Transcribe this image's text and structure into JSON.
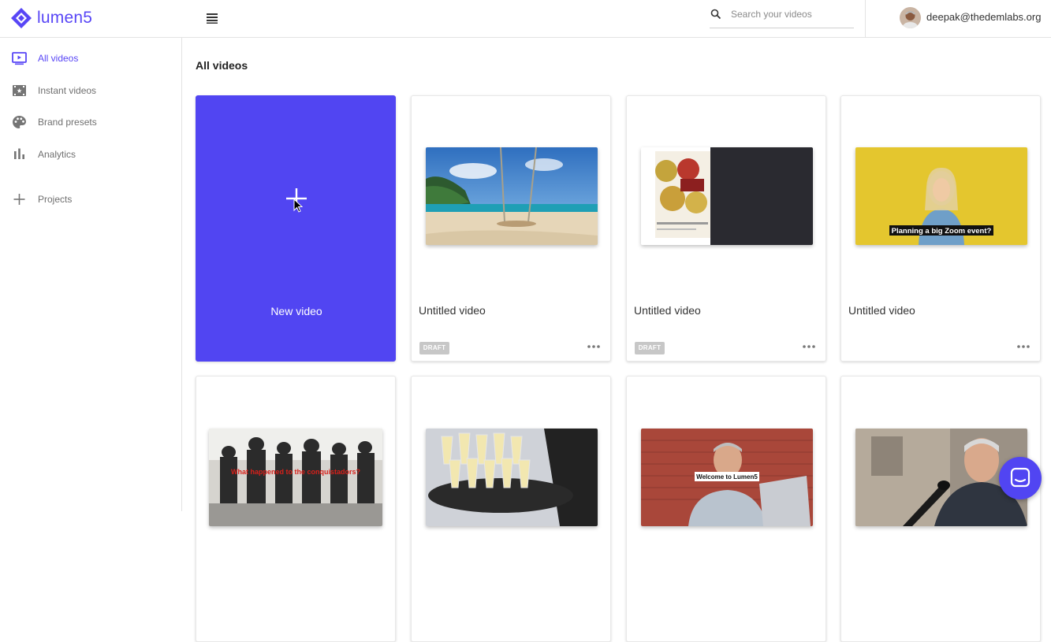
{
  "brand": {
    "name": "lumen5",
    "accent": "#5846f6",
    "primary_button": "#5145f2"
  },
  "header": {
    "search": {
      "placeholder": "Search your videos",
      "value": ""
    },
    "user": {
      "email": "deepak@thedemlabs.org"
    }
  },
  "sidebar": {
    "items": [
      {
        "label": "All videos",
        "icon": "play-screen-icon",
        "active": true
      },
      {
        "label": "Instant videos",
        "icon": "film-icon",
        "active": false
      },
      {
        "label": "Brand presets",
        "icon": "palette-icon",
        "active": false
      },
      {
        "label": "Analytics",
        "icon": "bar-chart-icon",
        "active": false
      },
      {
        "label": "Projects",
        "icon": "plus-icon",
        "active": false
      }
    ]
  },
  "main": {
    "title": "All videos",
    "new_video_label": "New video",
    "videos": [
      {
        "title": "Untitled video",
        "badge": "DRAFT",
        "thumbnail": "beach-swing"
      },
      {
        "title": "Untitled video",
        "badge": "DRAFT",
        "thumbnail": "coins-dark"
      },
      {
        "title": "Untitled video",
        "badge": "",
        "thumbnail": "yellow-woman",
        "caption": "Planning a big Zoom event?"
      },
      {
        "title": "",
        "badge": "",
        "thumbnail": "old-photo-soldiers",
        "caption": "What happened to the conquistadors?"
      },
      {
        "title": "",
        "badge": "",
        "thumbnail": "champagne-tray"
      },
      {
        "title": "",
        "badge": "",
        "thumbnail": "man-laptop",
        "caption": "Welcome to Lumen5"
      },
      {
        "title": "",
        "badge": "",
        "thumbnail": "man-microphone"
      }
    ]
  }
}
